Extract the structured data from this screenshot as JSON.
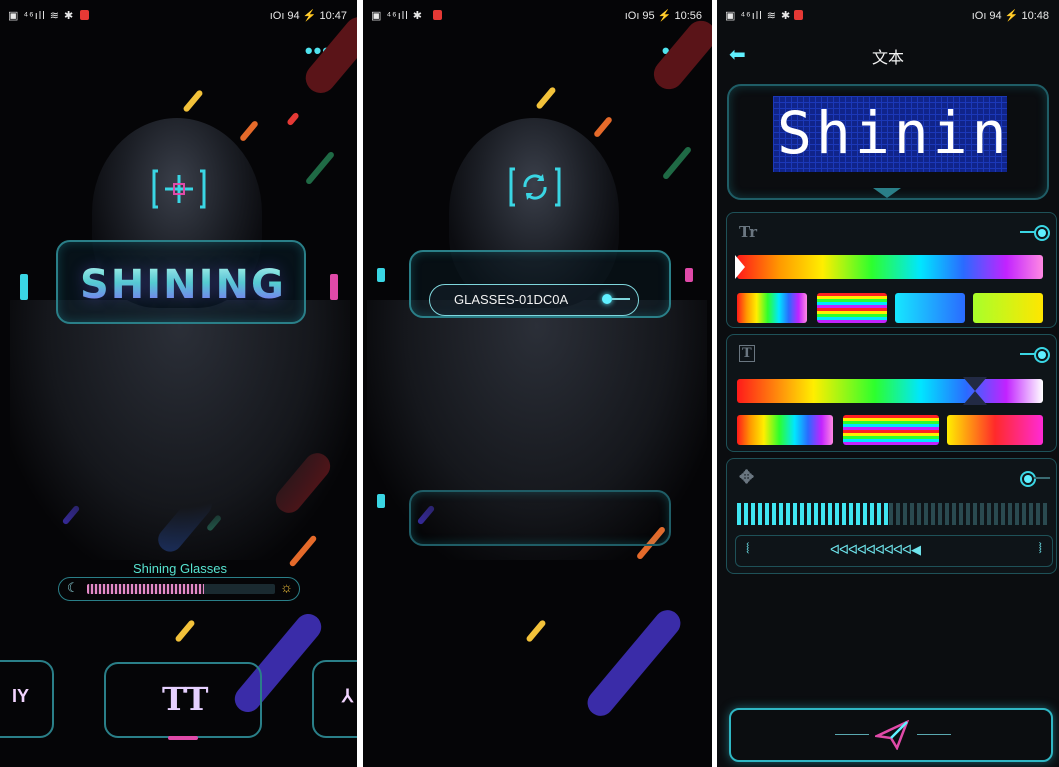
{
  "screens": [
    {
      "status": {
        "left": "▣ ⁴⁶ıll ≋ ✱",
        "right": "ıΟı 94 ⚡ 10:47"
      },
      "more_menu_glyph": "•••",
      "logo_text": "SHINING",
      "helmet_icon": "crosshair-icon",
      "brightness_label": "Shining Glasses",
      "brightness_level": 0.62,
      "brightness_low_glyph": "☾",
      "brightness_high_glyph": "☼",
      "nav_text_icon_glyph": "TT",
      "nav_left_glyph": "IY",
      "nav_right_glyph": "⅄"
    },
    {
      "status": {
        "left": "▣ ⁴⁶ıll ✱",
        "right": "ıΟı 95 ⚡ 10:56"
      },
      "more_menu_glyph": "•••",
      "helmet_icon": "refresh-icon",
      "device_name": "GLASSES-01DC0A"
    },
    {
      "status": {
        "left": "▣ ⁴⁶ıll ≋ ✱",
        "right": "ıΟı 94 ⚡ 10:48"
      },
      "back_glyph": "⬅",
      "title": "文本",
      "preview_text": "Shinin",
      "sections": [
        {
          "icon": "Tr"
        },
        {
          "icon": "T"
        },
        {
          "icon": "✥"
        }
      ],
      "direction_left_glyph": "⧙",
      "direction_arrows": "ᐊᐊᐊᐊᐊᐊᐊᐊᐊ◀",
      "direction_right_glyph": "⧘"
    }
  ],
  "colors": {
    "accent": "#3ad6e4",
    "frame": "#2a7f88",
    "pink": "#e04aa8"
  }
}
